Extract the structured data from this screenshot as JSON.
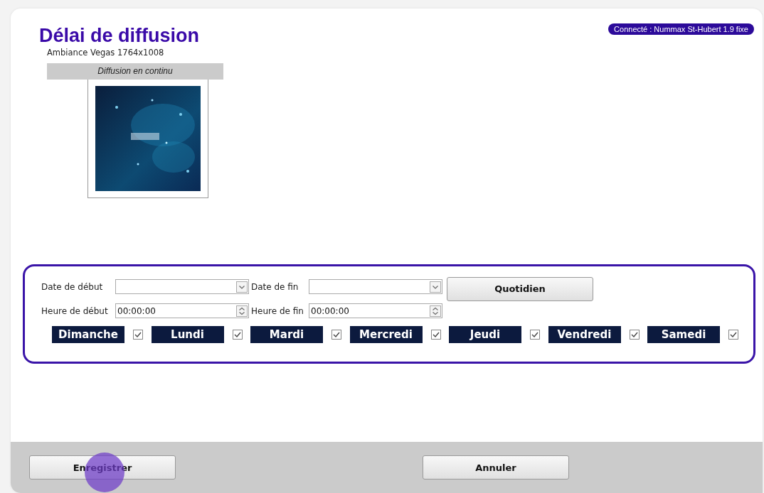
{
  "header": {
    "title": "Délai de diffusion",
    "subtitle": "Ambiance Vegas 1764x1008",
    "connection": "Connecté : Nummax St-Hubert 1.9 fixe"
  },
  "preview": {
    "caption": "Diffusion en continu",
    "kind": "picture"
  },
  "schedule": {
    "date_fields": [
      {
        "label": "Date de début"
      },
      {
        "label": "Date de fin"
      }
    ],
    "time_fields": [
      {
        "label": "Heure de début",
        "value": "00:00:00"
      },
      {
        "label": "Heure de fin",
        "value": "00:00:00"
      }
    ],
    "repeat_button": "Quotidien",
    "days": [
      {
        "label": "Dimanche",
        "checked": true
      },
      {
        "label": "Lundi",
        "checked": true
      },
      {
        "label": "Mardi",
        "checked": true
      },
      {
        "label": "Mercredi",
        "checked": true
      },
      {
        "label": "Jeudi",
        "checked": true
      },
      {
        "label": "Vendredi",
        "checked": true
      },
      {
        "label": "Samedi",
        "checked": true
      }
    ]
  },
  "footer": {
    "buttons": [
      "Enregistrer",
      "Annuler"
    ]
  }
}
